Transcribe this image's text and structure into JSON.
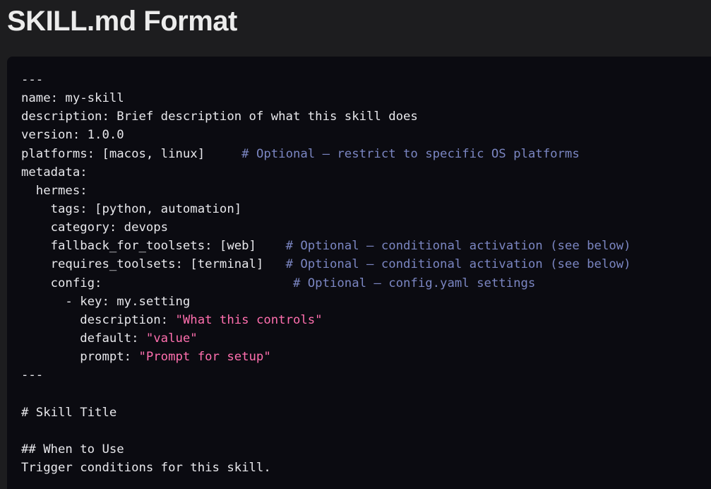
{
  "header": {
    "title": "SKILL.md Format"
  },
  "colors": {
    "background": "#1d1d1f",
    "code_background": "#0b0b11",
    "text": "#e8e8ec",
    "comment": "#7b86c2",
    "string": "#ff6fae"
  },
  "code": {
    "language": "markdown",
    "lines": [
      [
        {
          "t": "---",
          "k": "text"
        }
      ],
      [
        {
          "t": "name: my-skill",
          "k": "text"
        }
      ],
      [
        {
          "t": "description: Brief description of what this skill does",
          "k": "text"
        }
      ],
      [
        {
          "t": "version: 1.0.0",
          "k": "text"
        }
      ],
      [
        {
          "t": "platforms: [macos, linux]     ",
          "k": "text"
        },
        {
          "t": "# Optional — restrict to specific OS platforms",
          "k": "comment"
        }
      ],
      [
        {
          "t": "metadata:",
          "k": "text"
        }
      ],
      [
        {
          "t": "  hermes:",
          "k": "text"
        }
      ],
      [
        {
          "t": "    tags: [python, automation]",
          "k": "text"
        }
      ],
      [
        {
          "t": "    category: devops",
          "k": "text"
        }
      ],
      [
        {
          "t": "    fallback_for_toolsets: [web]    ",
          "k": "text"
        },
        {
          "t": "# Optional — conditional activation (see below)",
          "k": "comment"
        }
      ],
      [
        {
          "t": "    requires_toolsets: [terminal]   ",
          "k": "text"
        },
        {
          "t": "# Optional — conditional activation (see below)",
          "k": "comment"
        }
      ],
      [
        {
          "t": "    config:                          ",
          "k": "text"
        },
        {
          "t": "# Optional — config.yaml settings",
          "k": "comment"
        }
      ],
      [
        {
          "t": "      - key: my.setting",
          "k": "text"
        }
      ],
      [
        {
          "t": "        description: ",
          "k": "text"
        },
        {
          "t": "\"What this controls\"",
          "k": "string"
        }
      ],
      [
        {
          "t": "        default: ",
          "k": "text"
        },
        {
          "t": "\"value\"",
          "k": "string"
        }
      ],
      [
        {
          "t": "        prompt: ",
          "k": "text"
        },
        {
          "t": "\"Prompt for setup\"",
          "k": "string"
        }
      ],
      [
        {
          "t": "---",
          "k": "text"
        }
      ],
      [],
      [
        {
          "t": "# Skill Title",
          "k": "text"
        }
      ],
      [],
      [
        {
          "t": "## When to Use",
          "k": "text"
        }
      ],
      [
        {
          "t": "Trigger conditions for this skill.",
          "k": "text"
        }
      ]
    ]
  }
}
